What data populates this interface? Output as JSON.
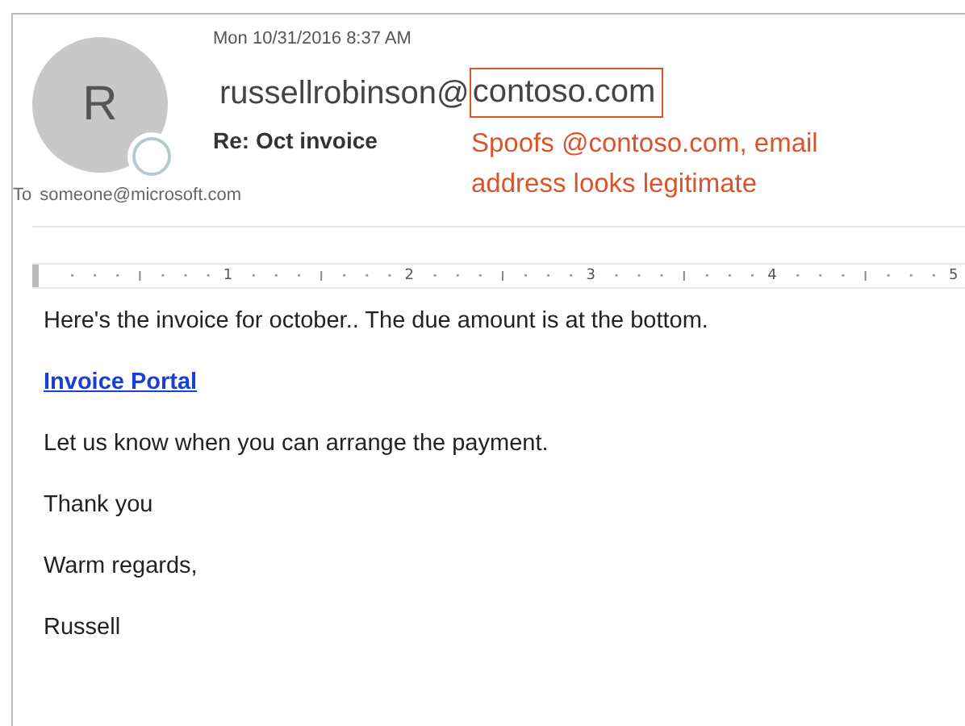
{
  "email": {
    "date": "Mon 10/31/2016 8:37 AM",
    "avatar_letter": "R",
    "sender_local": "russellrobinson@",
    "sender_domain": "contoso.com",
    "subject": "Re: Oct invoice",
    "to_label": "To",
    "to": "someone@microsoft.com"
  },
  "annotation": {
    "lines": [
      "Spoofs @contoso.com, email",
      "address looks legitimate"
    ]
  },
  "ruler": {
    "labels": [
      "1",
      "2",
      "3",
      "4",
      "5"
    ]
  },
  "body": [
    {
      "kind": "text",
      "text": "Here's the invoice for october.. The due amount is at the bottom."
    },
    {
      "kind": "link",
      "text": "Invoice Portal"
    },
    {
      "kind": "text",
      "text": "Let us know when you can arrange the payment."
    },
    {
      "kind": "text",
      "text": "Thank you"
    },
    {
      "kind": "text",
      "text": "Warm regards,"
    },
    {
      "kind": "text",
      "text": "Russell"
    }
  ]
}
